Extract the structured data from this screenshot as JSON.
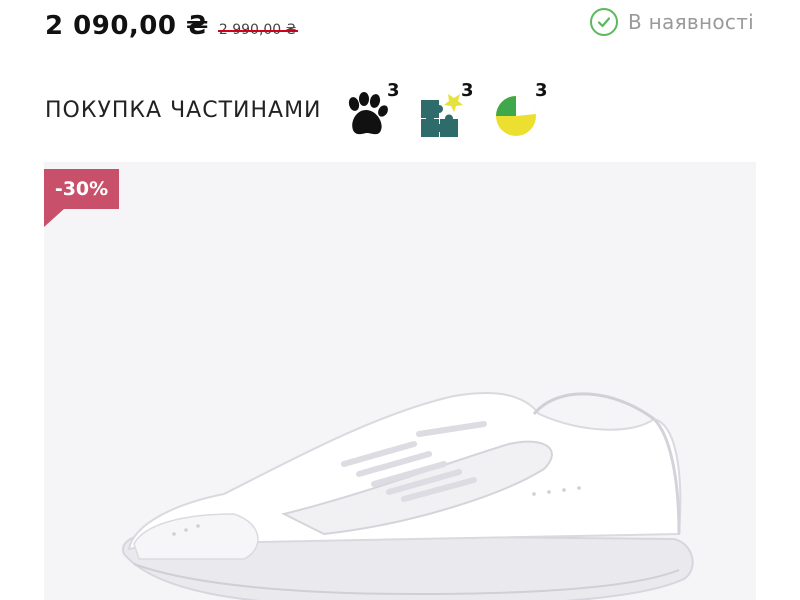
{
  "price": {
    "current": "2 090,00 ₴",
    "old": "2 990,00 ₴"
  },
  "stock": {
    "status": "В наявності",
    "icon": "check-circle-icon",
    "color": "#5cb85c"
  },
  "installments": {
    "label": "ПОКУПКА ЧАСТИНАМИ",
    "options": [
      {
        "icon": "paw-icon",
        "count": "3"
      },
      {
        "icon": "puzzle-icon",
        "count": "3"
      },
      {
        "icon": "pie-chart-icon",
        "count": "3"
      }
    ]
  },
  "product": {
    "discount": "-30%",
    "discount_color": "#c9506a",
    "image": "white-sneaker-image"
  }
}
